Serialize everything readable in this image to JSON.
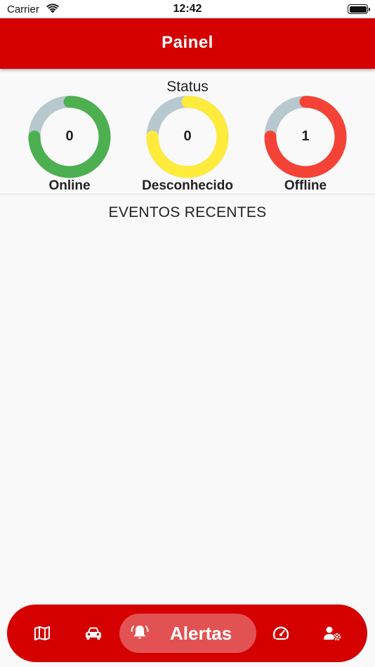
{
  "status_bar": {
    "carrier": "Carrier",
    "time": "12:42"
  },
  "app_bar": {
    "title": "Painel"
  },
  "status": {
    "title": "Status",
    "gauges": [
      {
        "label": "Online",
        "value": "0",
        "color": "#4caf50",
        "fraction": 0.75
      },
      {
        "label": "Desconhecido",
        "value": "0",
        "color": "#ffeb3b",
        "fraction": 0.75
      },
      {
        "label": "Offline",
        "value": "1",
        "color": "#f44336",
        "fraction": 0.75
      }
    ],
    "track_color": "#b8c8cf"
  },
  "events": {
    "title": "EVENTOS RECENTES"
  },
  "bottom_nav": {
    "items": [
      {
        "icon": "map-icon"
      },
      {
        "icon": "car-icon"
      },
      {
        "icon": "bell-alert-icon",
        "label": "Alertas",
        "active": true
      },
      {
        "icon": "speedometer-icon"
      },
      {
        "icon": "user-settings-icon"
      }
    ]
  }
}
